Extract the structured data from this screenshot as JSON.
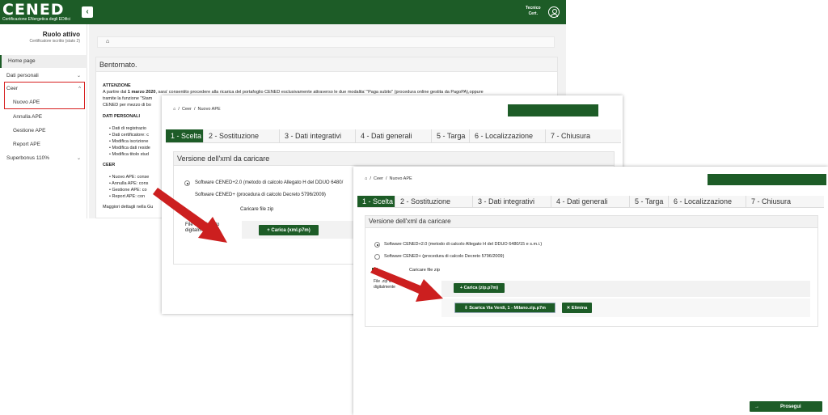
{
  "header": {
    "logo_text": "CENED",
    "logo_subtitle": "Certificazione ENergetica degli EDifici",
    "collapse_icon": "chevron-left-icon",
    "user_role_line1": "Tecnico",
    "user_role_line2": "Cert.",
    "user_icon": "user-circle-icon"
  },
  "sidebar": {
    "role_title": "Ruolo attivo",
    "role_subtitle": "Certificatore iscritto (stato 2)",
    "items": [
      {
        "label": "Home page"
      },
      {
        "label": "Dati personali"
      },
      {
        "label": "Ceer"
      },
      {
        "label": "Nuovo APE"
      },
      {
        "label": "Annulla APE"
      },
      {
        "label": "Gestione APE"
      },
      {
        "label": "Report APE"
      },
      {
        "label": "Superbonus 110%"
      }
    ],
    "highlight_color": "#d72020"
  },
  "home": {
    "home_icon": "home-icon",
    "welcome": "Bentornato.",
    "attention_title": "ATTENZIONE",
    "attention_line1_a": "A partire dal ",
    "attention_line1_b": "1 marzo 2020",
    "attention_line1_c": ", sara' consentito procedere alla ricarica del portafoglio CENED esclusivamente attraverso le due modalita' \"Paga subito\" (procedura online gestita da PagoPA),oppure",
    "attention_line2": "tramite la funzione \"Stam",
    "attention_line3": "CENED per mezzo di bo",
    "personal_title": "DATI PERSONALI",
    "personal_items": [
      "Dati di registrazio",
      "Dati certificatore: c",
      "Modifica iscrizione",
      "Modifica dati reside",
      "Modifica titolo stud"
    ],
    "ceer_title": "CEER",
    "ceer_items": [
      "Nuovo APE: conse",
      "Annulla APE: cons",
      "Gestione APE: co",
      "Report APE: con"
    ],
    "more": "Maggiori dettagli nella Gu"
  },
  "panel2": {
    "breadcrumb": [
      "Ceer",
      "Nuovo APE"
    ],
    "tabs": [
      "1 - Scelta",
      "2 - Sostituzione",
      "3 - Dati integrativi",
      "4 - Dati generali",
      "5 - Targa",
      "6 - Localizzazione",
      "7 - Chiusura"
    ],
    "section_title": "Versione dell'xml da caricare",
    "option1": "Software CENED+2.0 (metodo di calcolo Allegato H del DDUO 6480/",
    "option2": "Software CENED+ (procedura di calcolo Decreto 5796/2009)",
    "upload_zip": "Caricare file zip",
    "file_label_1": "File .xml firmato",
    "file_label_2": "digitalmente *",
    "upload_button": "Carica (xml.p7m)"
  },
  "panel3": {
    "breadcrumb": [
      "Ceer",
      "Nuovo APE"
    ],
    "tabs": [
      "1 - Scelta",
      "2 - Sostituzione",
      "3 - Dati integrativi",
      "4 - Dati generali",
      "5 - Targa",
      "6 - Localizzazione",
      "7 - Chiusura"
    ],
    "section_title": "Versione dell'xml da caricare",
    "option1": "Software CENED+2.0 (metodo di calcolo Allegato H del DDUO 6480/15 e s.m.i.)",
    "option2": "Software CENED+ (procedura di calcolo Decreto 5796/2009)",
    "upload_zip": "Caricare file zip",
    "file_label_1": "File .zip firmato",
    "file_label_2": "digitalmente",
    "upload_button": "Carica (zip.p7m)",
    "download_button": "Scarica Via Verdi, 1 - Milano.zip.p7m",
    "delete_button": "Elimina",
    "next_button": "Prosegui"
  },
  "colors": {
    "brand_green": "#1d5c27",
    "arrow_red": "#cc1f1f"
  }
}
